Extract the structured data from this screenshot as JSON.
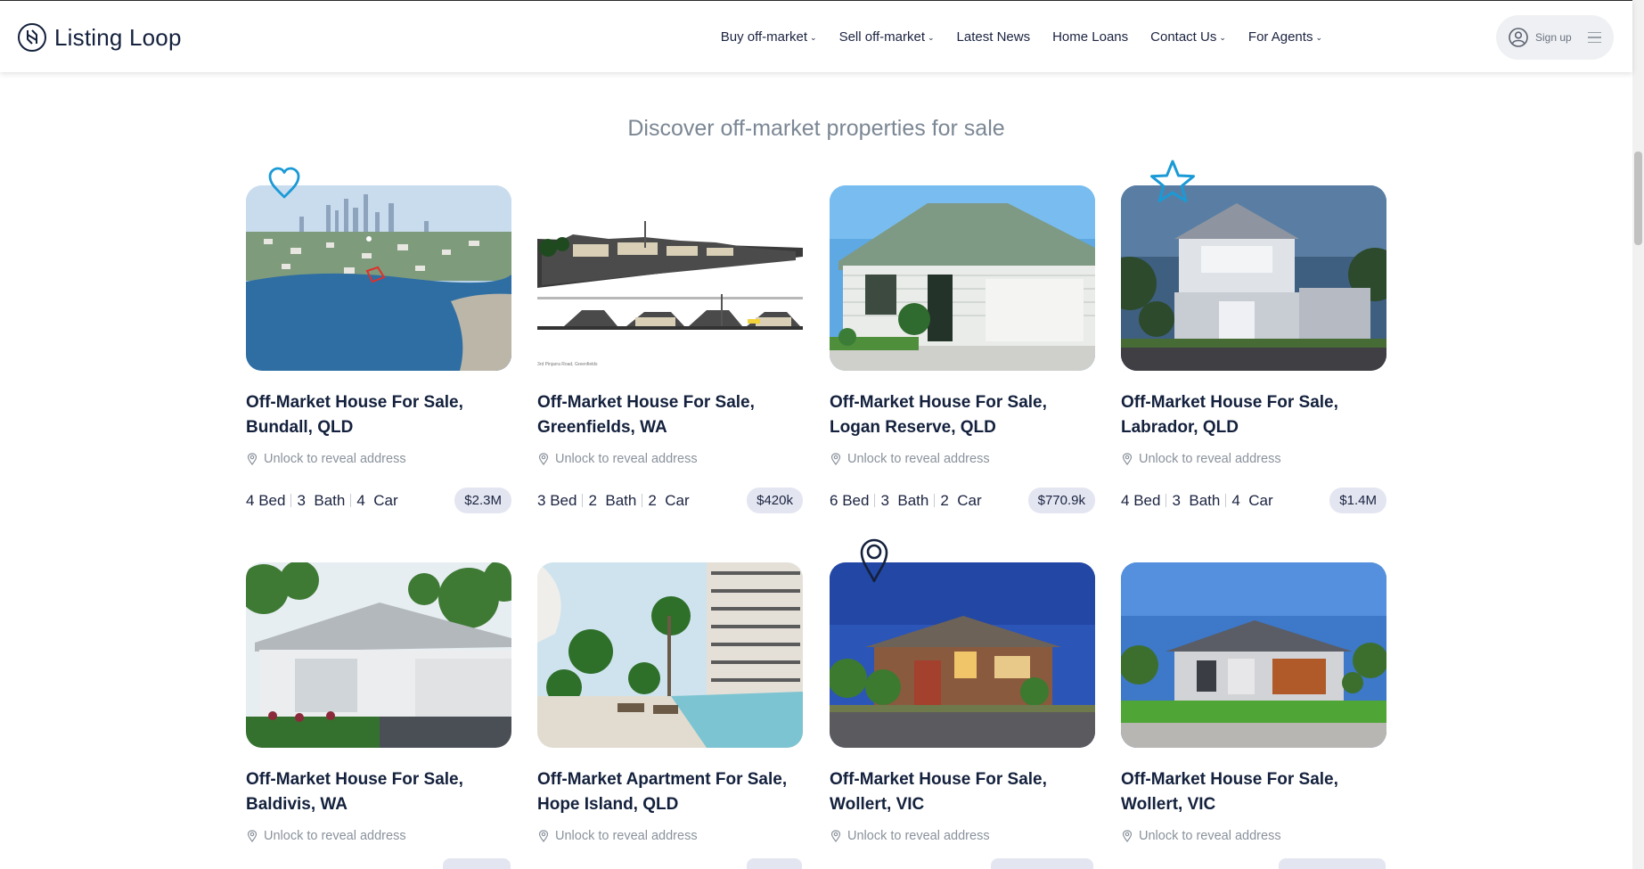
{
  "header": {
    "logo_text": "Listing Loop",
    "nav": [
      {
        "label": "Buy off-market",
        "dropdown": true
      },
      {
        "label": "Sell off-market",
        "dropdown": true
      },
      {
        "label": "Latest News",
        "dropdown": false
      },
      {
        "label": "Home Loans",
        "dropdown": false
      },
      {
        "label": "Contact Us",
        "dropdown": true
      },
      {
        "label": "For Agents",
        "dropdown": true
      }
    ],
    "signup_label": "Sign up"
  },
  "section": {
    "title": "Discover off-market properties for sale"
  },
  "listings": [
    {
      "title": "Off-Market House For Sale, Bundall, QLD",
      "address": "Unlock to reveal address",
      "bed": "4",
      "bath": "3",
      "car": "4",
      "price": "$2.3M",
      "image": "aerial-waterfront"
    },
    {
      "title": "Off-Market House For Sale, Greenfields, WA",
      "address": "Unlock to reveal address",
      "bed": "3",
      "bath": "2",
      "car": "2",
      "price": "$420k",
      "image": "site-elevation-render",
      "image_caption": "3rd Pinjarra Road, Greenfields"
    },
    {
      "title": "Off-Market House For Sale, Logan Reserve, QLD",
      "address": "Unlock to reveal address",
      "bed": "6",
      "bath": "3",
      "car": "2",
      "price": "$770.9k",
      "image": "single-storey-house"
    },
    {
      "title": "Off-Market House For Sale, Labrador, QLD",
      "address": "Unlock to reveal address",
      "bed": "4",
      "bath": "3",
      "car": "4",
      "price": "$1.4M",
      "image": "double-storey-house"
    },
    {
      "title": "Off-Market House For Sale, Baldivis, WA",
      "address": "Unlock to reveal address",
      "image": "modern-render"
    },
    {
      "title": "Off-Market Apartment For Sale, Hope Island, QLD",
      "address": "Unlock to reveal address",
      "image": "apartment-pool"
    },
    {
      "title": "Off-Market House For Sale, Wollert, VIC",
      "address": "Unlock to reveal address",
      "image": "brick-house"
    },
    {
      "title": "Off-Market House For Sale, Wollert, VIC",
      "address": "Unlock to reveal address",
      "image": "grey-house"
    }
  ],
  "labels": {
    "bed": "Bed",
    "bath": "Bath",
    "car": "Car"
  },
  "decorations": [
    "heart-icon",
    "star-icon",
    "map-pin-icon"
  ],
  "colors": {
    "brand_dark": "#14213d",
    "accent_blue": "#1a9ad6",
    "price_badge": "#e3e6f1",
    "muted_text": "#8a929c",
    "heading_grey": "#7b8794"
  }
}
